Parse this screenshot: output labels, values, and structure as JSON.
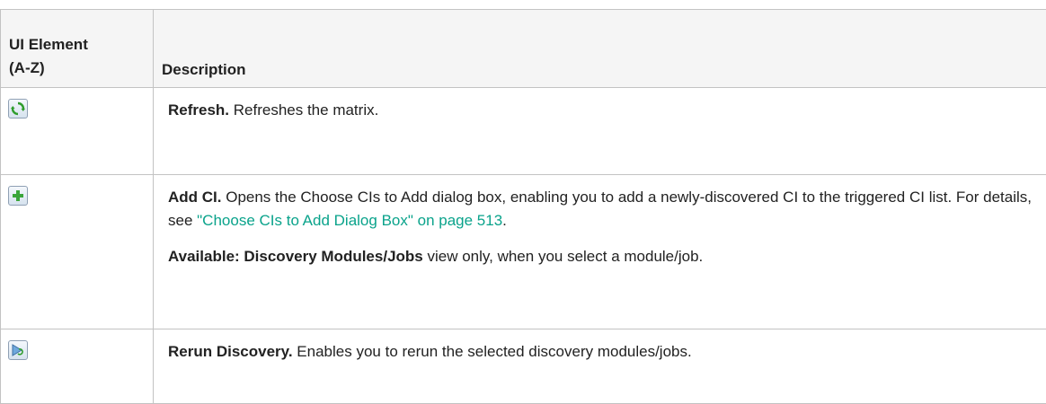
{
  "table": {
    "headers": {
      "col1_line1": "UI Element",
      "col1_line2": "(A-Z)",
      "col2": "Description"
    },
    "rows": [
      {
        "icon": "refresh-icon",
        "title": "Refresh.",
        "text": " Refreshes the matrix."
      },
      {
        "icon": "add-ci-icon",
        "title": "Add CI.",
        "text": " Opens the Choose CIs to Add dialog box, enabling you to add a newly-discovered CI to the triggered CI list. For details, see ",
        "link": "\"Choose CIs to Add Dialog Box\" on page 513",
        "after_link": ".",
        "note_bold": "Available: Discovery Modules/Jobs",
        "note_text": " view only, when you select a module/job."
      },
      {
        "icon": "rerun-discovery-icon",
        "title": "Rerun Discovery.",
        "text": " Enables you to rerun the selected discovery modules/jobs."
      }
    ]
  },
  "colors": {
    "link": "#0aa38b",
    "border": "#c3c3c3",
    "header_bg": "#f5f5f5"
  }
}
